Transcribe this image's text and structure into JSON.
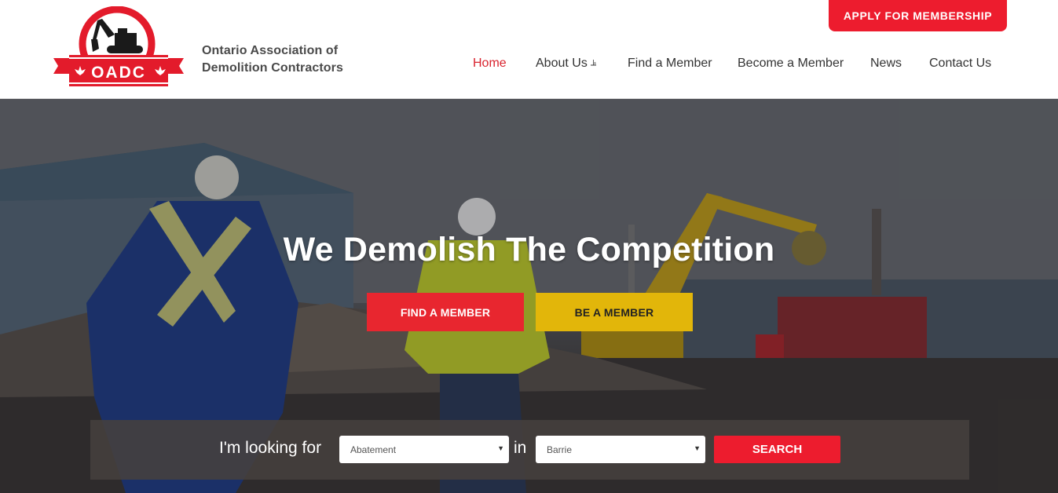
{
  "header": {
    "logo_text": "OADC",
    "org_name_line1": "Ontario Association of",
    "org_name_line2": "Demolition Contractors",
    "apply_label": "APPLY FOR MEMBERSHIP"
  },
  "nav": {
    "items": [
      {
        "label": "Home",
        "active": true
      },
      {
        "label": "About Us",
        "has_dropdown": true
      },
      {
        "label": "Find a Member"
      },
      {
        "label": "Become a Member"
      },
      {
        "label": "News"
      },
      {
        "label": "Contact Us"
      }
    ],
    "dropdown_icon": "double-chevron-down-icon"
  },
  "hero": {
    "title": "We Demolish The Competition",
    "find_member_label": "FIND A MEMBER",
    "be_member_label": "BE A MEMBER"
  },
  "search": {
    "label": "I'm looking for",
    "category_value": "Abatement",
    "in_label": "in",
    "location_value": "Barrie",
    "button_label": "SEARCH"
  },
  "colors": {
    "brand_red": "#ed1c2e",
    "accent_yellow": "#e2b60a",
    "nav_active": "#d9232e"
  }
}
